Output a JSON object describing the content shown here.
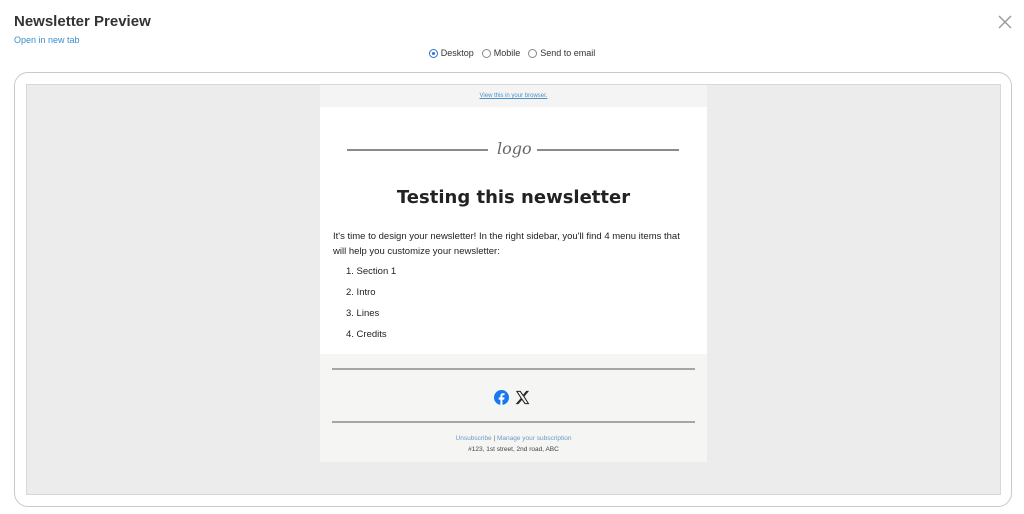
{
  "modal": {
    "title": "Newsletter Preview",
    "open_new_tab": "Open in new tab"
  },
  "view_options": [
    {
      "label": "Desktop",
      "checked": true
    },
    {
      "label": "Mobile",
      "checked": false
    },
    {
      "label": "Send to email",
      "checked": false
    }
  ],
  "email": {
    "view_in_browser": "View this in your browser.",
    "logo_text": "logo",
    "heading": "Testing this newsletter",
    "body_text": "It's time to design your newsletter! In the right sidebar, you'll find 4 menu items that will help you customize your newsletter:",
    "list_items": [
      "1. Section 1",
      "2. Intro",
      "3. Lines",
      "4. Credits"
    ],
    "footer": {
      "social_icons": [
        "facebook-icon",
        "x-icon"
      ],
      "unsubscribe": "Unsubscribe",
      "separator": "|",
      "manage_subscription": "Manage your subscription",
      "address": "#123, 1st street, 2nd road, ABC"
    }
  },
  "colors": {
    "link": "#3a8fd1",
    "radio_selected": "#2b6fd6",
    "facebook": "#1877f2",
    "canvas_bg": "#ececec"
  }
}
